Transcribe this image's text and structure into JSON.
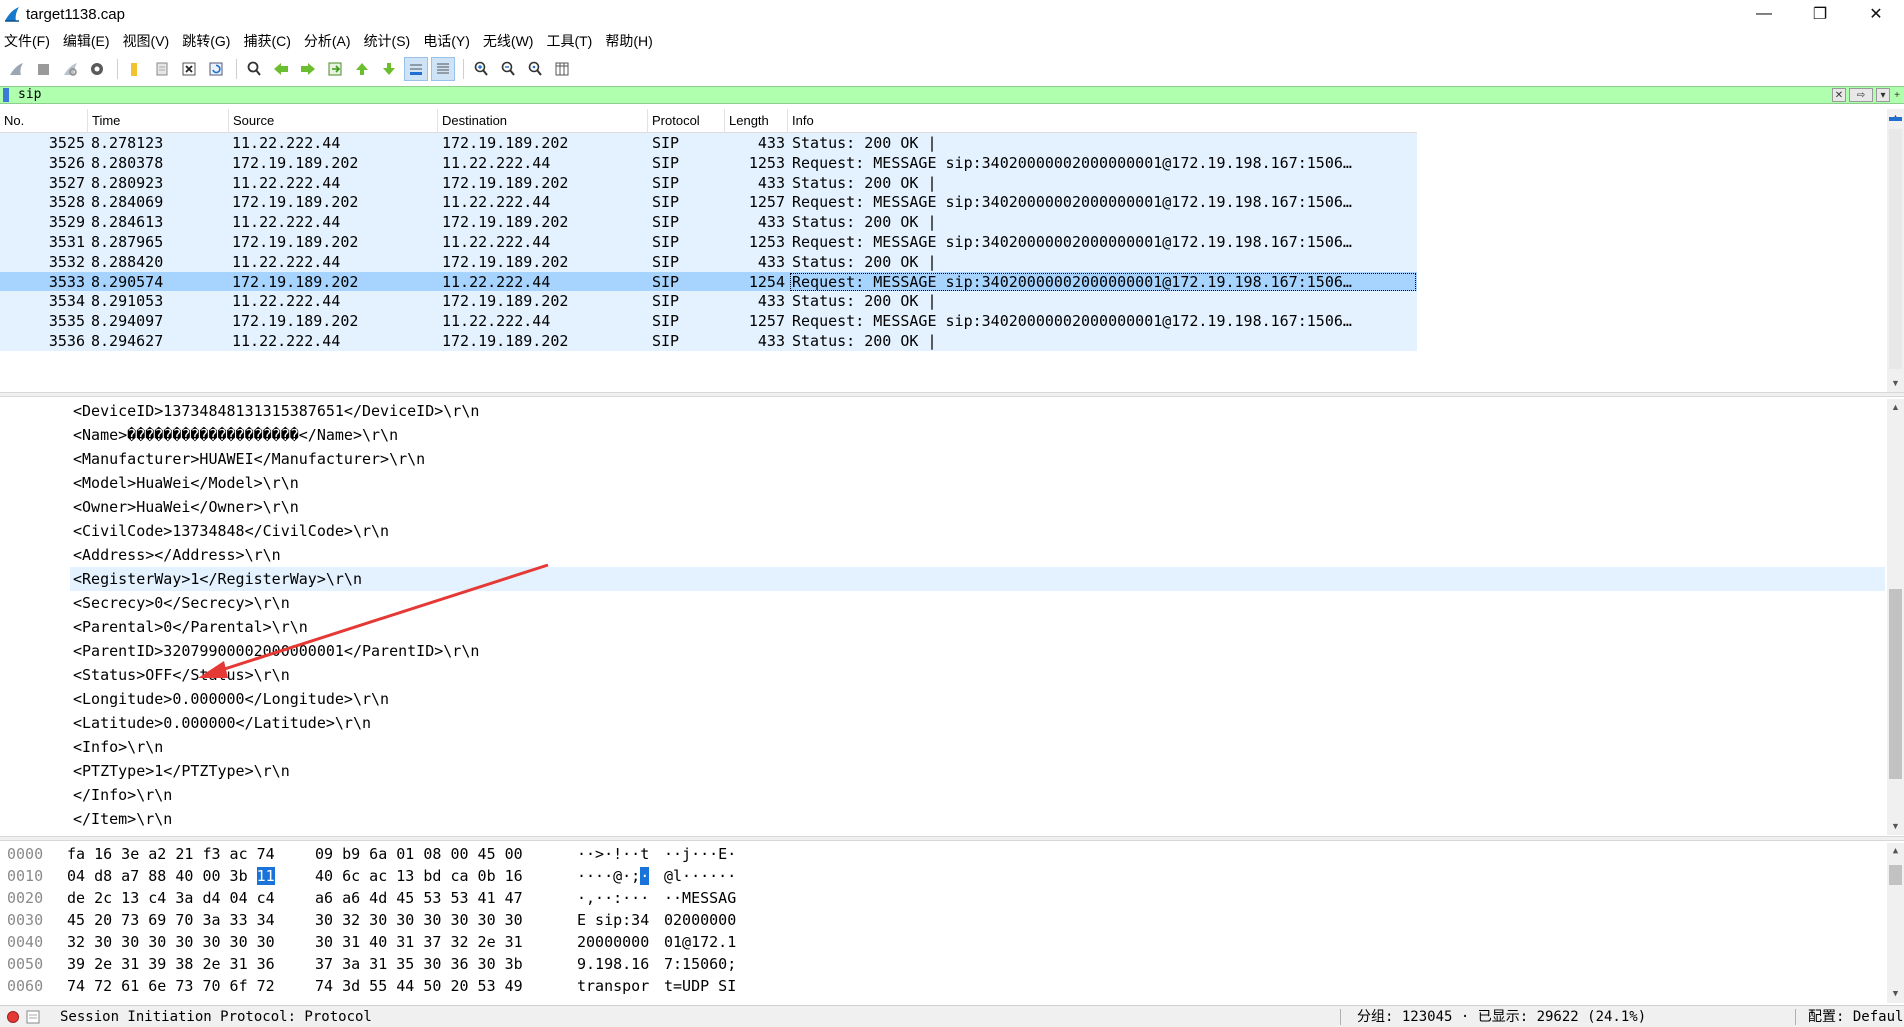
{
  "window": {
    "title": "target1138.cap",
    "minimize": "—",
    "restore": "❐",
    "close": "✕"
  },
  "menu": [
    "文件(F)",
    "编辑(E)",
    "视图(V)",
    "跳转(G)",
    "捕获(C)",
    "分析(A)",
    "统计(S)",
    "电话(Y)",
    "无线(W)",
    "工具(T)",
    "帮助(H)"
  ],
  "filter": {
    "value": "sip"
  },
  "packet_list": {
    "columns": [
      "No.",
      "Time",
      "Source",
      "Destination",
      "Protocol",
      "Length",
      "Info"
    ],
    "rows": [
      {
        "no": "3525",
        "time": "8.278123",
        "src": "11.22.222.44",
        "dst": "172.19.189.202",
        "proto": "SIP",
        "len": "433",
        "info": "Status: 200 OK |"
      },
      {
        "no": "3526",
        "time": "8.280378",
        "src": "172.19.189.202",
        "dst": "11.22.222.44",
        "proto": "SIP",
        "len": "1253",
        "info": "Request: MESSAGE sip:34020000002000000001@172.19.198.167:1506…"
      },
      {
        "no": "3527",
        "time": "8.280923",
        "src": "11.22.222.44",
        "dst": "172.19.189.202",
        "proto": "SIP",
        "len": "433",
        "info": "Status: 200 OK |"
      },
      {
        "no": "3528",
        "time": "8.284069",
        "src": "172.19.189.202",
        "dst": "11.22.222.44",
        "proto": "SIP",
        "len": "1257",
        "info": "Request: MESSAGE sip:34020000002000000001@172.19.198.167:1506…"
      },
      {
        "no": "3529",
        "time": "8.284613",
        "src": "11.22.222.44",
        "dst": "172.19.189.202",
        "proto": "SIP",
        "len": "433",
        "info": "Status: 200 OK |"
      },
      {
        "no": "3531",
        "time": "8.287965",
        "src": "172.19.189.202",
        "dst": "11.22.222.44",
        "proto": "SIP",
        "len": "1253",
        "info": "Request: MESSAGE sip:34020000002000000001@172.19.198.167:1506…"
      },
      {
        "no": "3532",
        "time": "8.288420",
        "src": "11.22.222.44",
        "dst": "172.19.189.202",
        "proto": "SIP",
        "len": "433",
        "info": "Status: 200 OK |"
      },
      {
        "no": "3533",
        "time": "8.290574",
        "src": "172.19.189.202",
        "dst": "11.22.222.44",
        "proto": "SIP",
        "len": "1254",
        "info": "Request: MESSAGE sip:34020000002000000001@172.19.198.167:1506…",
        "selected": true
      },
      {
        "no": "3534",
        "time": "8.291053",
        "src": "11.22.222.44",
        "dst": "172.19.189.202",
        "proto": "SIP",
        "len": "433",
        "info": "Status: 200 OK |"
      },
      {
        "no": "3535",
        "time": "8.294097",
        "src": "172.19.189.202",
        "dst": "11.22.222.44",
        "proto": "SIP",
        "len": "1257",
        "info": "Request: MESSAGE sip:34020000002000000001@172.19.198.167:1506…"
      },
      {
        "no": "3536",
        "time": "8.294627",
        "src": "11.22.222.44",
        "dst": "172.19.189.202",
        "proto": "SIP",
        "len": "433",
        "info": "Status: 200 OK |"
      }
    ]
  },
  "details": {
    "lines": [
      "<DeviceID>13734848131315387651</DeviceID>\\r\\n",
      "<Name>�������������������</Name>\\r\\n",
      "<Manufacturer>HUAWEI</Manufacturer>\\r\\n",
      "<Model>HuaWei</Model>\\r\\n",
      "<Owner>HuaWei</Owner>\\r\\n",
      "<CivilCode>13734848</CivilCode>\\r\\n",
      "<Address></Address>\\r\\n",
      "<RegisterWay>1</RegisterWay>\\r\\n",
      "<Secrecy>0</Secrecy>\\r\\n",
      "<Parental>0</Parental>\\r\\n",
      "<ParentID>32079900002000000001</ParentID>\\r\\n",
      "<Status>OFF</Status>\\r\\n",
      "<Longitude>0.000000</Longitude>\\r\\n",
      "<Latitude>0.000000</Latitude>\\r\\n",
      "<Info>\\r\\n",
      "<PTZType>1</PTZType>\\r\\n",
      "</Info>\\r\\n",
      "</Item>\\r\\n"
    ],
    "highlight_index": 7,
    "arrow_color": "#e53935"
  },
  "hex": {
    "rows": [
      {
        "off": "0000",
        "hex1": "fa 16 3e a2 21 f3 ac 74",
        "hex2": "09 b9 6a 01 08 00 45 00",
        "asc1": "··>·!··t",
        "asc2": "··j···E·"
      },
      {
        "off": "0010",
        "hex1a": "04 d8 a7 88 40 00 3b ",
        "hexsel": "11",
        "hex2": "40 6c ac 13 bd ca 0b 16",
        "asc1a": "····@·;",
        "ascsel": "·",
        "asc2": "@l······"
      },
      {
        "off": "0020",
        "hex1": "de 2c 13 c4 3a d4 04 c4",
        "hex2": "a6 a6 4d 45 53 53 41 47",
        "asc1": "·,··:···",
        "asc2": "··MESSAG"
      },
      {
        "off": "0030",
        "hex1": "45 20 73 69 70 3a 33 34",
        "hex2": "30 32 30 30 30 30 30 30",
        "asc1": "E sip:34",
        "asc2": "02000000"
      },
      {
        "off": "0040",
        "hex1": "32 30 30 30 30 30 30 30",
        "hex2": "30 31 40 31 37 32 2e 31",
        "asc1": "20000000",
        "asc2": "01@172.1"
      },
      {
        "off": "0050",
        "hex1": "39 2e 31 39 38 2e 31 36",
        "hex2": "37 3a 31 35 30 36 30 3b",
        "asc1": "9.198.16",
        "asc2": "7:15060;"
      },
      {
        "off": "0060",
        "hex1": "74 72 61 6e 73 70 6f 72",
        "hex2": "74 3d 55 44 50 20 53 49",
        "asc1": "transpor",
        "asc2": "t=UDP SI"
      }
    ]
  },
  "status": {
    "text": "Session Initiation Protocol: Protocol",
    "packets": "分组: 123045 · 已显示: 29622 (24.1%)",
    "profile": "配置: Defaul"
  },
  "colors": {
    "row_bg": "#e4f2ff",
    "row_selected": "#a6d4ff",
    "filter_ok": "#afffaf",
    "hex_selected": "#1a73d9"
  }
}
